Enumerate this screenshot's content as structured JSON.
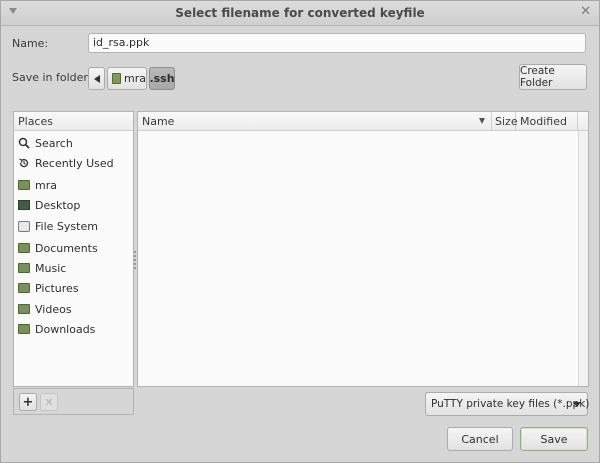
{
  "window": {
    "title": "Select filename for converted keyfile",
    "close_glyph": "✕"
  },
  "name_row": {
    "label": "Name:",
    "value": "id_rsa.ppk"
  },
  "folder_row": {
    "label": "Save in folder:",
    "crumbs": [
      {
        "label": "mra",
        "icon": "home-folder-icon"
      },
      {
        "label": ".ssh",
        "active": true
      }
    ],
    "create_folder_label": "Create Folder"
  },
  "places": {
    "header": "Places",
    "items": [
      {
        "label": "Search",
        "icon": "search-icon"
      },
      {
        "label": "Recently Used",
        "icon": "recent-icon"
      },
      {
        "label": "mra",
        "icon": "home-folder-icon"
      },
      {
        "label": "Desktop",
        "icon": "desktop-icon"
      },
      {
        "label": "File System",
        "icon": "drive-icon"
      },
      {
        "label": "Documents",
        "icon": "folder-icon"
      },
      {
        "label": "Music",
        "icon": "folder-icon"
      },
      {
        "label": "Pictures",
        "icon": "folder-icon"
      },
      {
        "label": "Videos",
        "icon": "folder-icon"
      },
      {
        "label": "Downloads",
        "icon": "folder-icon"
      }
    ],
    "add_glyph": "+",
    "remove_glyph": "✕"
  },
  "files": {
    "columns": {
      "name": "Name",
      "size": "Size",
      "modified": "Modified"
    },
    "rows": []
  },
  "filter": {
    "selected": "PuTTY private key files (*.ppk)"
  },
  "actions": {
    "cancel_label": "Cancel",
    "save_label": "Save"
  }
}
